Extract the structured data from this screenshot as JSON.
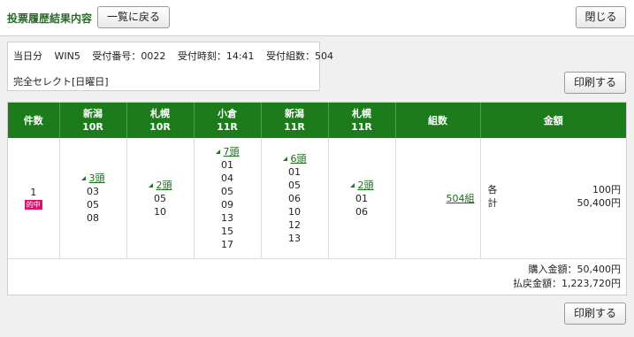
{
  "header": {
    "title": "投票履歴結果内容",
    "back_label": "一覧に戻る",
    "close_label": "閉じる"
  },
  "info": {
    "day": "当日分",
    "bet_type": "WIN5",
    "receipt_no": "受付番号：0022",
    "receipt_time": "受付時刻：14:41",
    "receipt_combos": "受付組数：504",
    "method": "完全セレクト[日曜日]"
  },
  "print_label": "印刷する",
  "table": {
    "headers": [
      {
        "line1": "件数",
        "line2": ""
      },
      {
        "line1": "新潟",
        "line2": "10R"
      },
      {
        "line1": "札幌",
        "line2": "10R"
      },
      {
        "line1": "小倉",
        "line2": "11R"
      },
      {
        "line1": "新潟",
        "line2": "11R"
      },
      {
        "line1": "札幌",
        "line2": "11R"
      },
      {
        "line1": "組数",
        "line2": ""
      },
      {
        "line1": "金額",
        "line2": ""
      }
    ],
    "row": {
      "count": "1",
      "badge": "的中",
      "picks": [
        {
          "head": "3頭",
          "horses": [
            "03",
            "05",
            "08"
          ]
        },
        {
          "head": "2頭",
          "horses": [
            "05",
            "10"
          ]
        },
        {
          "head": "7頭",
          "horses": [
            "01",
            "04",
            "05",
            "09",
            "13",
            "15",
            "17"
          ]
        },
        {
          "head": "6頭",
          "horses": [
            "01",
            "05",
            "06",
            "10",
            "12",
            "13"
          ]
        },
        {
          "head": "2頭",
          "horses": [
            "01",
            "06"
          ]
        }
      ],
      "combos": "504組",
      "each_label": "各",
      "each_value": "100円",
      "total_label": "計",
      "total_value": "50,400円"
    }
  },
  "totals": {
    "purchase": "購入金額：50,400円",
    "refund": "払戻金額：1,223,720円"
  },
  "colors": {
    "header_green": "#1c7c1c",
    "title_green": "#2b6a2b",
    "hit_badge": "#e0116e"
  }
}
